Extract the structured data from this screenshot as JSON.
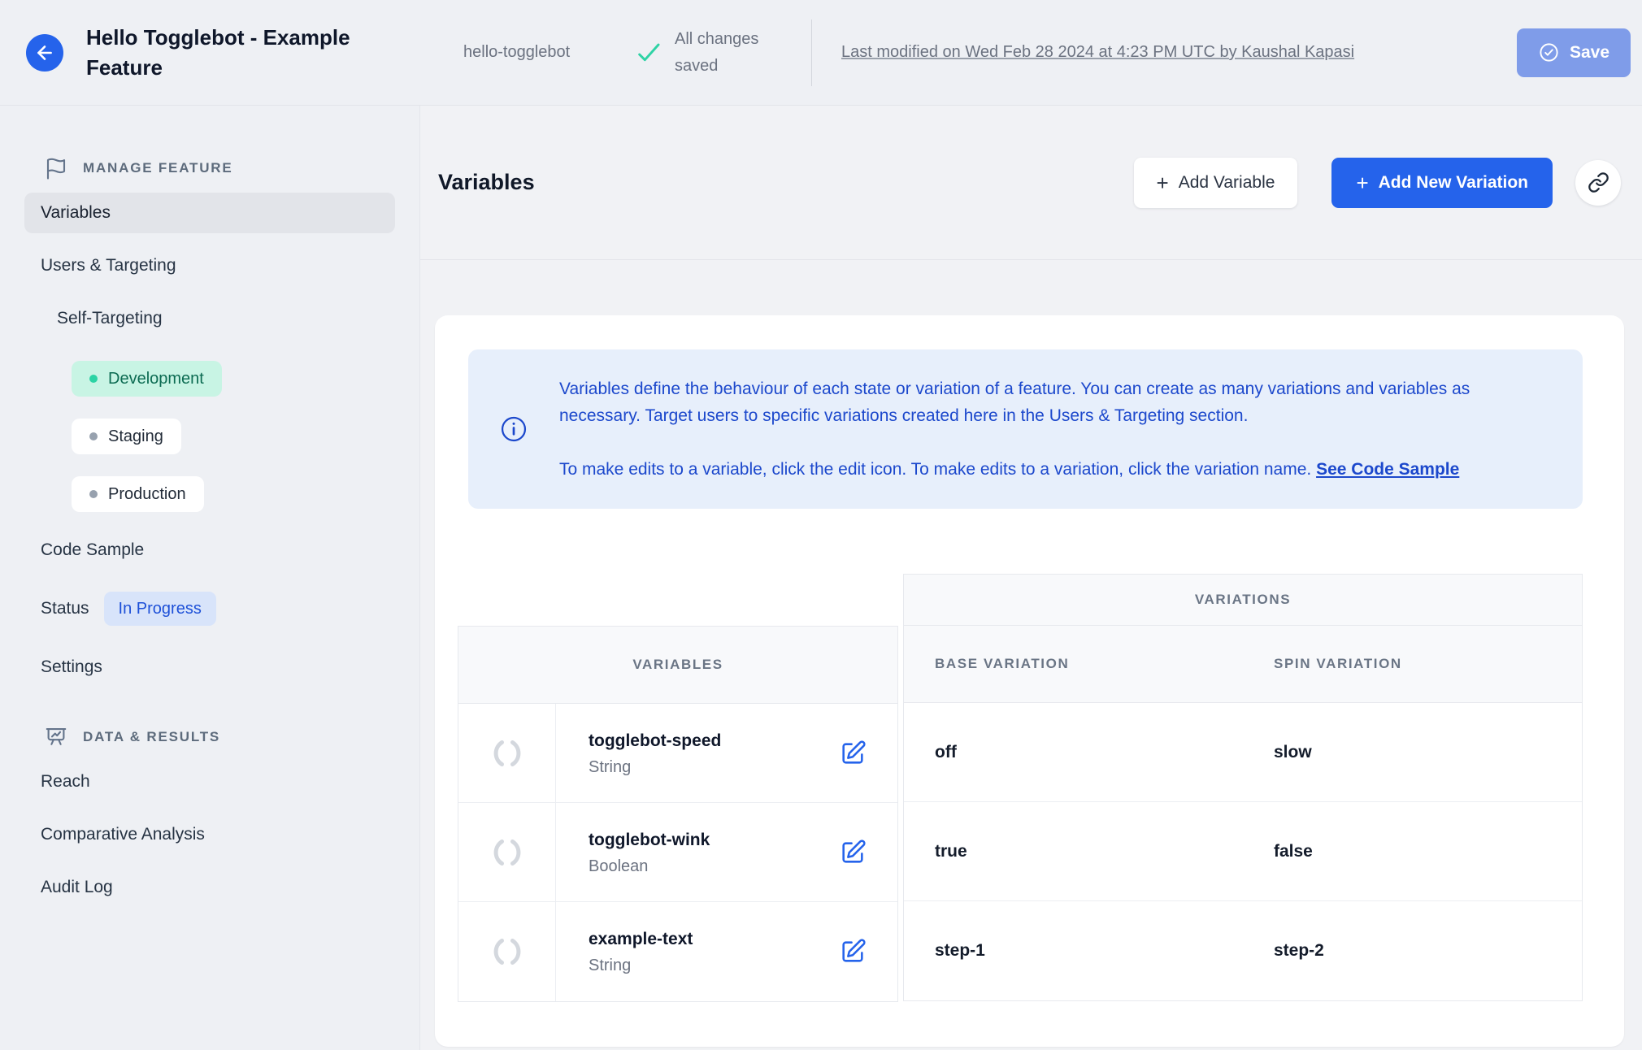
{
  "header": {
    "title": "Hello Togglebot - Example Feature",
    "feature_key": "hello-togglebot",
    "save_status": "All changes saved",
    "last_modified": "Last modified on Wed Feb 28 2024 at 4:23 PM UTC by Kaushal Kapasi",
    "save_label": "Save"
  },
  "sidebar": {
    "manage_section": {
      "label": "MANAGE FEATURE",
      "items": {
        "variables": "Variables",
        "users_targeting": "Users & Targeting",
        "self_targeting": "Self-Targeting",
        "development": "Development",
        "staging": "Staging",
        "production": "Production",
        "code_sample": "Code Sample",
        "status": "Status",
        "status_badge": "In Progress",
        "settings": "Settings"
      }
    },
    "data_section": {
      "label": "DATA & RESULTS",
      "items": {
        "reach": "Reach",
        "comparative_analysis": "Comparative Analysis",
        "audit_log": "Audit Log"
      }
    }
  },
  "toolbar": {
    "title": "Variables",
    "plus": "+",
    "add_variable": "Add Variable",
    "add_new_variation": "Add New Variation"
  },
  "info_box": {
    "paragraph1": "Variables define the behaviour of each state or variation of a feature. You can create as many variations and variables as necessary. Target users to specific variations created here in the Users & Targeting section.",
    "paragraph2": "To make edits to a variable, click the edit icon. To make edits to a variation, click the variation name. ",
    "link": "See Code Sample"
  },
  "table": {
    "variations_header": "VARIATIONS",
    "variables_header": "VARIABLES",
    "base_header": "BASE VARIATION",
    "spin_header": "SPIN VARIATION",
    "rows": [
      {
        "name": "togglebot-speed",
        "type": "String",
        "base": "off",
        "spin": "slow"
      },
      {
        "name": "togglebot-wink",
        "type": "Boolean",
        "base": "true",
        "spin": "false"
      },
      {
        "name": "example-text",
        "type": "String",
        "base": "step-1",
        "spin": "step-2"
      }
    ]
  },
  "colors": {
    "primary_blue": "#2563eb",
    "save_disabled_blue": "#7f9ce9",
    "info_box_bg": "#e7effb",
    "info_text_blue": "#1c48cc",
    "success_green": "#2bd3a4",
    "development_badge_bg": "#c8f4e4",
    "in_progress_badge_bg": "#d8e4fa",
    "in_progress_text": "#1d50d8",
    "page_bg": "#eef0f4",
    "table_header_bg": "#f8f9fb"
  }
}
